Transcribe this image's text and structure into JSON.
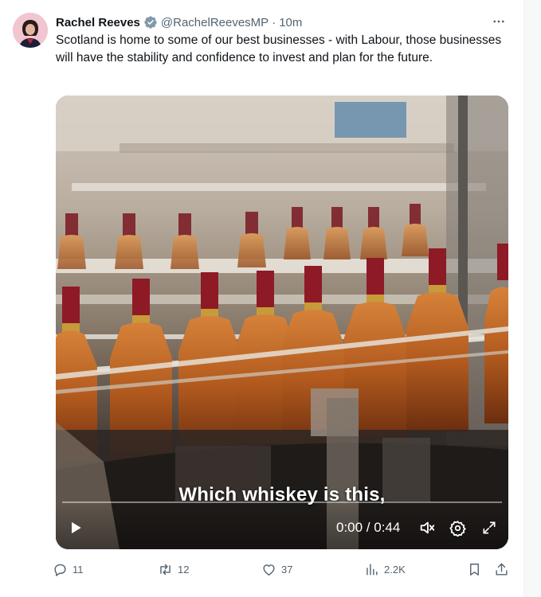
{
  "tweet": {
    "author_name": "Rachel Reeves",
    "handle": "@RachelReevesMP",
    "separator": "·",
    "time": "10m",
    "text": "Scotland is home to some of our best businesses - with Labour, those businesses will have the stability and confidence to invest and plan for the future."
  },
  "video": {
    "caption": "Which whiskey is this,",
    "timecode": "0:00 / 0:44",
    "progress": 0.0
  },
  "actions": {
    "replies": "11",
    "reposts": "12",
    "likes": "37",
    "views": "2.2K"
  },
  "colors": {
    "verified": "#829aab",
    "muted": "#536471",
    "text": "#0f1419"
  },
  "icons": {
    "verified": "verified-badge-icon",
    "more": "more-icon",
    "play": "play-icon",
    "volume": "volume-icon",
    "settings": "gear-icon",
    "fullscreen": "fullscreen-icon",
    "reply": "reply-icon",
    "repost": "repost-icon",
    "like": "heart-icon",
    "views": "views-icon",
    "bookmark": "bookmark-icon",
    "share": "share-icon"
  }
}
